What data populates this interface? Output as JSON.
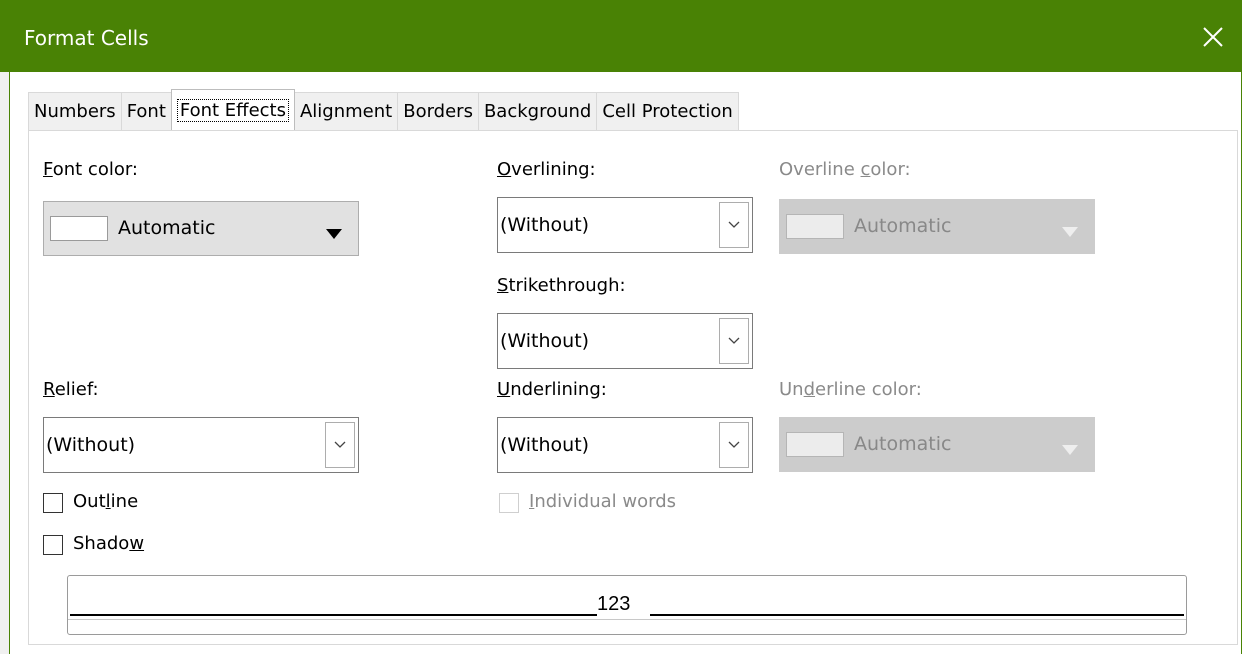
{
  "window": {
    "title": "Format Cells",
    "close_icon": "close-icon"
  },
  "tabs": [
    {
      "label": "Numbers",
      "active": false
    },
    {
      "label": "Font",
      "active": false
    },
    {
      "label": "Font Effects",
      "active": true
    },
    {
      "label": "Alignment",
      "active": false
    },
    {
      "label": "Borders",
      "active": false
    },
    {
      "label": "Background",
      "active": false
    },
    {
      "label": "Cell Protection",
      "active": false
    }
  ],
  "font_color": {
    "mnemonic": "F",
    "label_rest": "ont color:",
    "value": "Automatic"
  },
  "overlining": {
    "mnemonic": "O",
    "label_rest": "verlining:",
    "value": "(Without)"
  },
  "overline_color": {
    "label_pre": "Overline ",
    "mnemonic": "c",
    "label_rest": "olor:",
    "value": "Automatic",
    "enabled": false
  },
  "strikethrough": {
    "mnemonic": "S",
    "label_rest": "trikethrough:",
    "value": "(Without)"
  },
  "relief": {
    "mnemonic": "R",
    "label_rest": "elief:",
    "value": "(Without)"
  },
  "underlining": {
    "mnemonic": "U",
    "label_rest": "nderlining:",
    "value": "(Without)"
  },
  "underline_color": {
    "label_pre": "Un",
    "mnemonic": "d",
    "label_rest": "erline color:",
    "value": "Automatic",
    "enabled": false
  },
  "outline": {
    "label_pre": "Out",
    "mnemonic": "l",
    "label_rest": "ine",
    "checked": false
  },
  "shadow": {
    "label_pre": "Shado",
    "mnemonic": "w",
    "label_rest": "",
    "checked": false
  },
  "individual_words": {
    "mnemonic": "I",
    "label_rest": "ndividual words",
    "checked": false,
    "enabled": false
  },
  "preview": {
    "text": "123"
  },
  "colors": {
    "titlebar": "#498205",
    "disabled_text": "#8a8a8a"
  }
}
